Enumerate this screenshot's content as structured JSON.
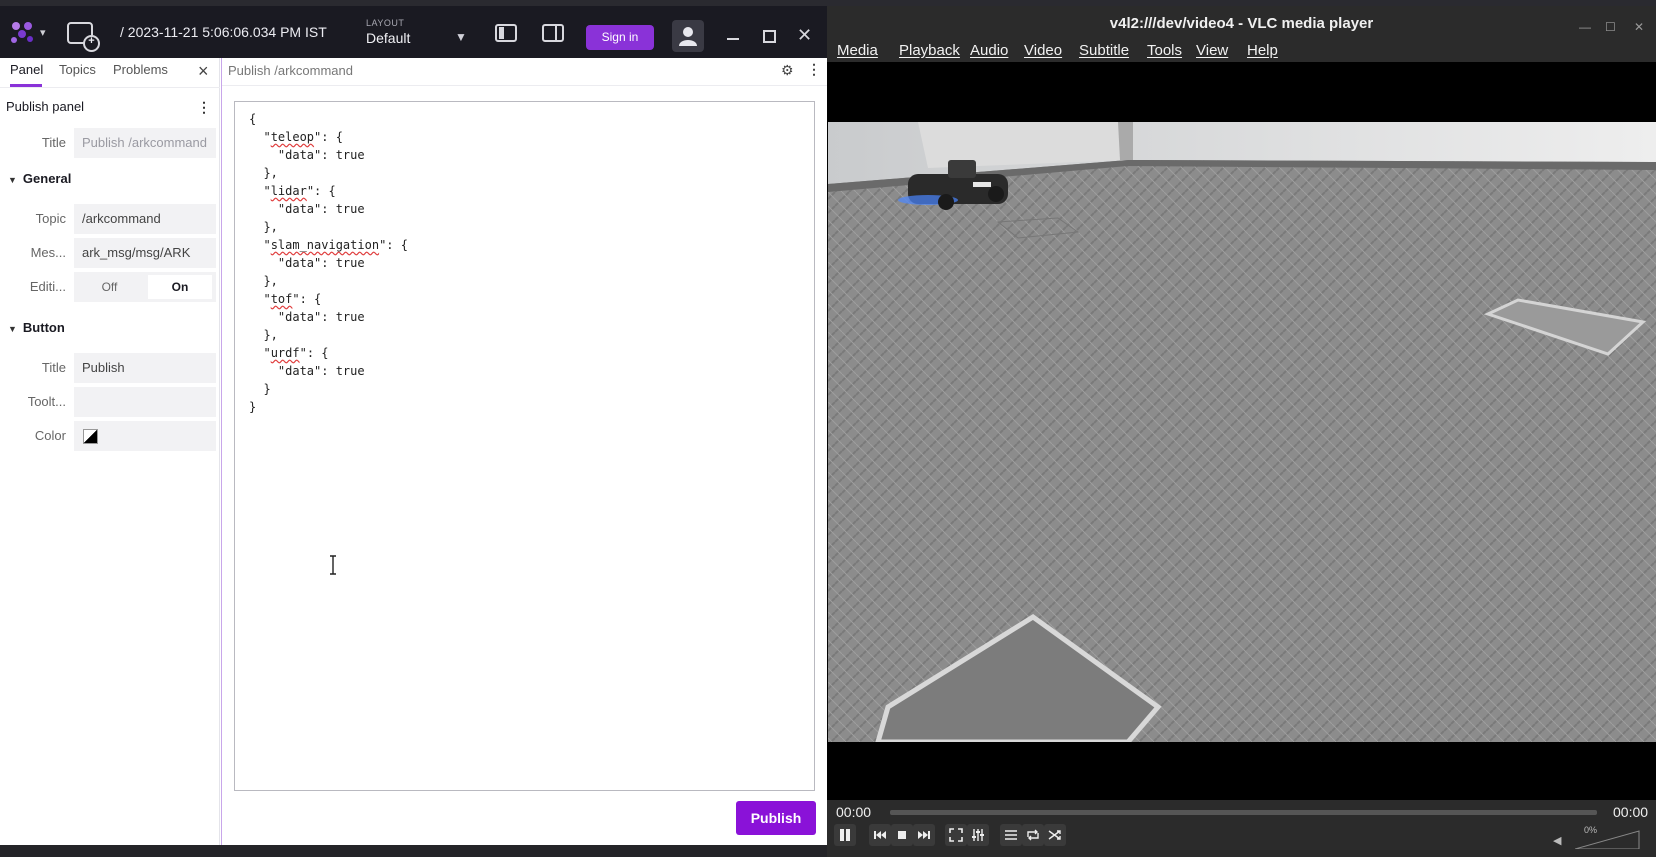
{
  "foxglove": {
    "timestamp": "/ 2023-11-21 5:06:06.034 PM IST",
    "layout_label": "LAYOUT",
    "layout_value": "Default",
    "sign_in": "Sign in",
    "sidebar_tabs": [
      "Panel",
      "Topics",
      "Problems"
    ],
    "panel_settings": {
      "title": "Publish panel",
      "title_label": "Title",
      "title_placeholder": "Publish /arkcommand",
      "general": {
        "heading": "General",
        "topic_label": "Topic",
        "topic_value": "/arkcommand",
        "message_label": "Mes...",
        "message_value": "ark_msg/msg/ARK",
        "editing_label": "Editi...",
        "editing_off": "Off",
        "editing_on": "On"
      },
      "button": {
        "heading": "Button",
        "title_label": "Title",
        "title_value": "Publish",
        "tooltip_label": "Toolt...",
        "tooltip_value": "",
        "color_label": "Color"
      }
    },
    "publish_panel": {
      "title": "Publish /arkcommand",
      "code_lines": [
        "{",
        "  \"teleop\": {",
        "    \"data\": true",
        "  },",
        "  \"lidar\": {",
        "    \"data\": true",
        "  },",
        "  \"slam_navigation\": {",
        "    \"data\": true",
        "  },",
        "  \"tof\": {",
        "    \"data\": true",
        "  },",
        "  \"urdf\": {",
        "    \"data\": true",
        "  }",
        "}"
      ],
      "publish_button": "Publish"
    },
    "accent_color": "#8a32d8"
  },
  "vlc": {
    "title": "v4l2:///dev/video4 - VLC media player",
    "menu": [
      "Media",
      "Playback",
      "Audio",
      "Video",
      "Subtitle",
      "Tools",
      "View",
      "Help"
    ],
    "time_elapsed": "00:00",
    "time_total": "00:00",
    "volume": "0%"
  }
}
